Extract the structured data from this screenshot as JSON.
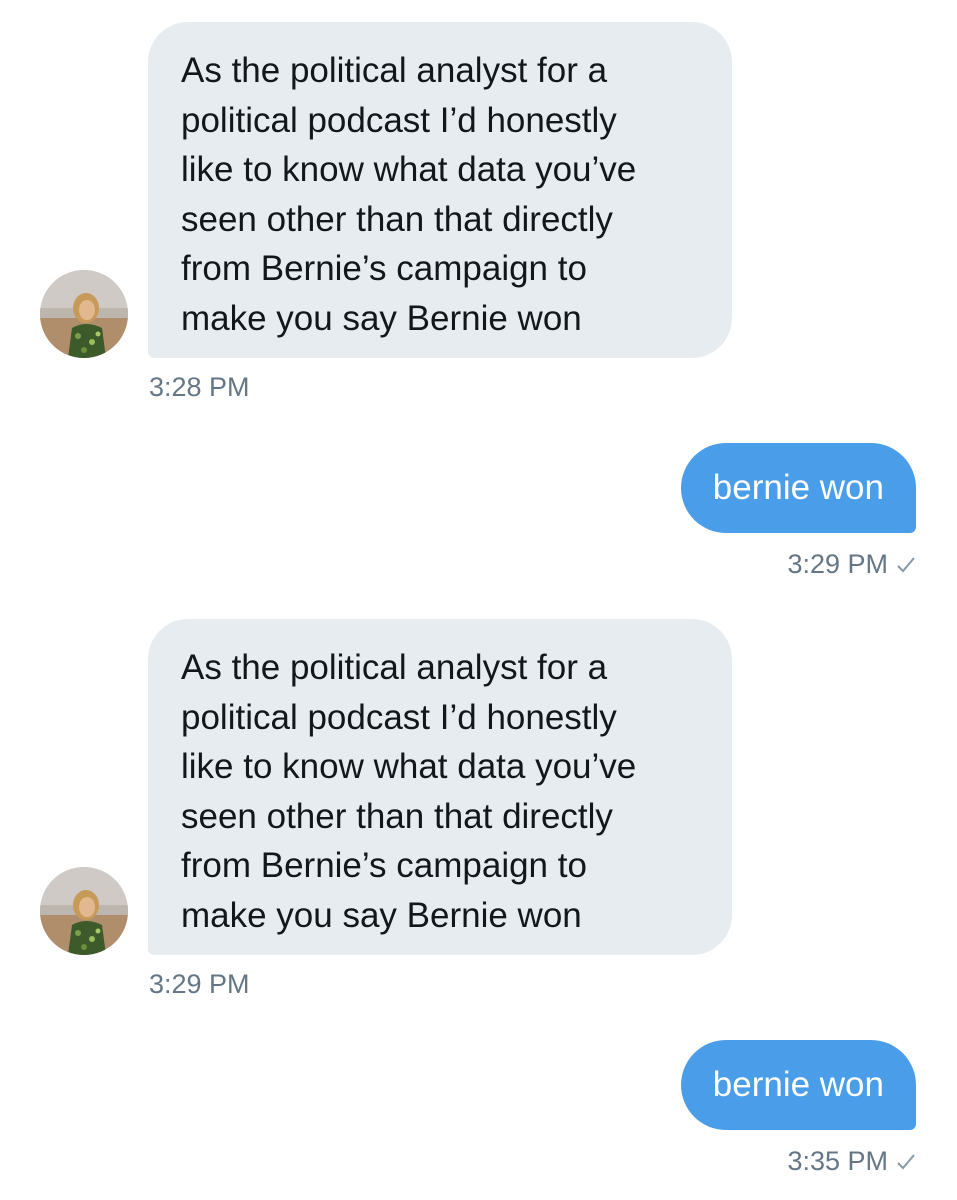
{
  "messages": [
    {
      "direction": "incoming",
      "text": "As the political analyst for a\npolitical podcast I’d honestly\nlike to know what data you’ve\nseen other than that directly\nfrom Bernie’s campaign to\nmake you say Bernie won",
      "time": "3:28 PM"
    },
    {
      "direction": "outgoing",
      "text": "bernie won",
      "time": "3:29 PM",
      "status_icon": "checkmark-icon"
    },
    {
      "direction": "incoming",
      "text": "As the political analyst for a\npolitical podcast I’d honestly\nlike to know what data you’ve\nseen other than that directly\nfrom Bernie’s campaign to\nmake you say Bernie won",
      "time": "3:29 PM"
    },
    {
      "direction": "outgoing",
      "text": "bernie won",
      "time": "3:35 PM",
      "status_icon": "checkmark-icon"
    }
  ],
  "colors": {
    "incoming_bubble": "#e6ecf0",
    "outgoing_bubble": "#4a9ee9",
    "incoming_text": "#14171a",
    "outgoing_text": "#ffffff",
    "timestamp": "#657786"
  }
}
